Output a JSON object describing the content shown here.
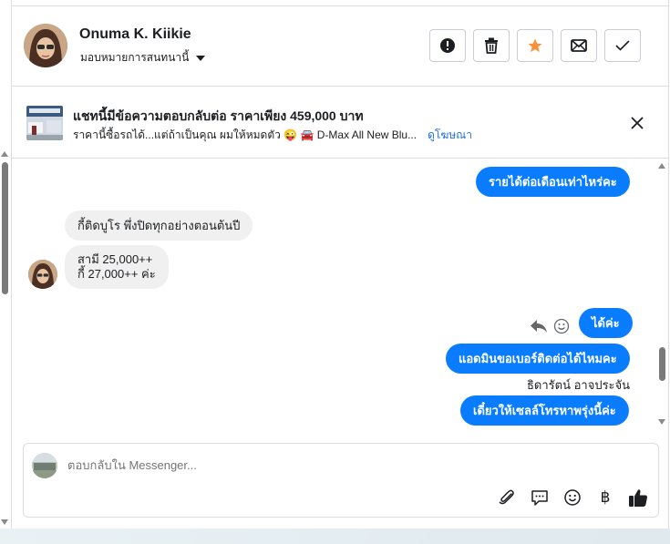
{
  "header": {
    "name": "Onuma K. Kiikie",
    "assign_label": "มอบหมายการสนทนานี้",
    "actions": [
      {
        "name": "spam-button",
        "icon": "alert-circle-icon"
      },
      {
        "name": "delete-button",
        "icon": "trash-icon"
      },
      {
        "name": "star-button",
        "icon": "star-icon",
        "color": "#f7923a"
      },
      {
        "name": "mark-unread-button",
        "icon": "envelope-icon"
      },
      {
        "name": "done-button",
        "icon": "check-icon"
      }
    ]
  },
  "ad": {
    "title": "แชทนี้มีข้อความตอบกลับต่อ ราคาเพียง 459,000 บาท",
    "subtitle": "ราคานี้ซื้อรถได้...แต่ถ้าเป็นคุณ ผมให้หมดตัว 😜 🚘 D-Max All New Blu...",
    "link": "ดูโฆษณา"
  },
  "messages": {
    "m1": "รายได้ต่อเดือนเท่าไหร่คะ",
    "m2": "กี้ติดบูโร  พึ่งปิดทุกอย่างตอนต้นปี",
    "m3_line1": "สามี  25,000++",
    "m3_line2": "กี้  27,000++ ค่ะ",
    "m4": "ได้ค่ะ",
    "m5": "แอดมินขอเบอร์ติดต่อได้ไหมคะ",
    "sender": "ธิดารัตน์ อาจประจัน",
    "m6": "เดี๋ยวให้เซลล์โทรหาพรุ่งนี้ค่ะ"
  },
  "composer": {
    "placeholder": "ตอบกลับใน Messenger...",
    "baht_symbol": "฿"
  },
  "colors": {
    "outgoing": "#0a7cff",
    "incoming": "#f0f0f0",
    "link": "#216fdb",
    "star": "#f7923a"
  }
}
